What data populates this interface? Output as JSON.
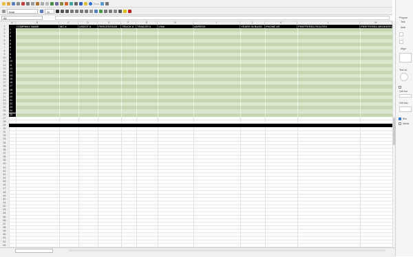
{
  "app": {
    "font_name": "Arial",
    "font_size": "11",
    "cell_ref": "A1"
  },
  "toolbar": {
    "style_label": "Find"
  },
  "columns": [
    "A",
    "B",
    "C",
    "D",
    "E",
    "F",
    "G",
    "H",
    "I",
    "J",
    "K",
    "L",
    "M"
  ],
  "headers": [
    "COMPANY NAME",
    "MC #",
    "USDOT #",
    "PERCENTAGE",
    "TRUCK #",
    "TRAILER #",
    "VIN#",
    "ADRESS",
    "YEARS IN BUSS",
    "PHONE #S",
    "PREFFERED ROUTES",
    "PREFFERED BROKERS"
  ],
  "row_numbers": [
    "1",
    "2",
    "3",
    "4",
    "5",
    "6",
    "7",
    "8",
    "9",
    "10",
    "11",
    "12",
    "13",
    "14",
    "15",
    "16",
    "17",
    "18",
    "19",
    "20",
    "21",
    "22",
    "23",
    "24",
    "25",
    "26",
    "27",
    "28",
    "29",
    "30",
    "31",
    "32",
    "33",
    "34",
    "35",
    "36",
    "37",
    "38",
    "39",
    "40",
    "41",
    "42",
    "43",
    "44",
    "45",
    "46",
    "47",
    "48",
    "49",
    "50",
    "51",
    "52",
    "53",
    "54",
    "55",
    "56",
    "57",
    "58",
    "59",
    "60",
    "61",
    "62",
    "63"
  ],
  "row_ids": [
    "1",
    "2",
    "3",
    "4",
    "5",
    "6",
    "7",
    "8",
    "9",
    "10",
    "11",
    "12",
    "13",
    "14",
    "15",
    "16",
    "17",
    "18",
    "19",
    "20",
    "21",
    "22",
    "23",
    "24",
    "25"
  ],
  "colors": {
    "band_dark": "#c5d7b0",
    "band_light": "#dbe7cb",
    "header_bg": "#000000",
    "header_text": "#ffffff"
  },
  "sidebar": {
    "title": "Proper",
    "text_section": "Text",
    "font": "Arial",
    "align_section": "Align",
    "text_orientation": "Text ori",
    "cell_border": "Cell bor",
    "cell_bg": "Cell bac",
    "show_grid": "Sho",
    "number_format": "Numb"
  }
}
